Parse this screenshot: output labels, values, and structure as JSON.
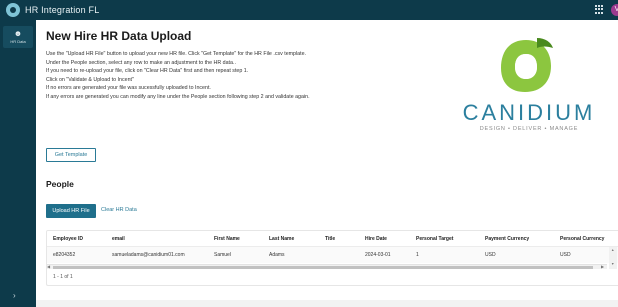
{
  "app": {
    "title": "HR Integration FL",
    "avatar_initial": "V"
  },
  "sidebar": {
    "items": [
      {
        "label": "HR Data",
        "icon": "people-icon"
      }
    ]
  },
  "page": {
    "title": "New Hire HR Data Upload",
    "instructions": [
      "Use the \"Upload HR File\" button to upload your new HR file. Click \"Get Template\" for the HR File .csv template.",
      "Under the People section, select any row to make an adjustment to the HR data..",
      "If you need to re-upload your file, click on \"Clear HR Data\" first and then repeat step 1.",
      "Click on \"Validate & Upload to Incent\"",
      "If no errors are generated your file was sucessfully uploaded to Incent.",
      "If any errors are generated you can modify any line under the People section following step 2 and validate again."
    ],
    "get_template_label": "Get Template"
  },
  "brand": {
    "name": "CANIDIUM",
    "tagline": "DESIGN • DELIVER • MANAGE",
    "colors": {
      "mark_green": "#8cc63f",
      "mark_dark": "#4a8a1e",
      "name_blue": "#2b7f9e"
    }
  },
  "people": {
    "title": "People",
    "upload_label": "Upload HR File",
    "clear_label": "Clear HR Data",
    "columns": [
      "Employee ID",
      "email",
      "First Name",
      "Last Name",
      "Title",
      "Hire Date",
      "Personal Target",
      "Payment Currency",
      "Personal Currency"
    ],
    "rows": [
      [
        "e8204352",
        "samueladams@canidium01.com",
        "Samuel",
        "Adams",
        "",
        "2024-03-01",
        "1",
        "USD",
        "USD"
      ]
    ],
    "pager": "1 - 1 of 1"
  },
  "colors": {
    "topbar": "#0d3a4a",
    "primary_button": "#1f6f8b",
    "accent": "#2a7a96"
  }
}
